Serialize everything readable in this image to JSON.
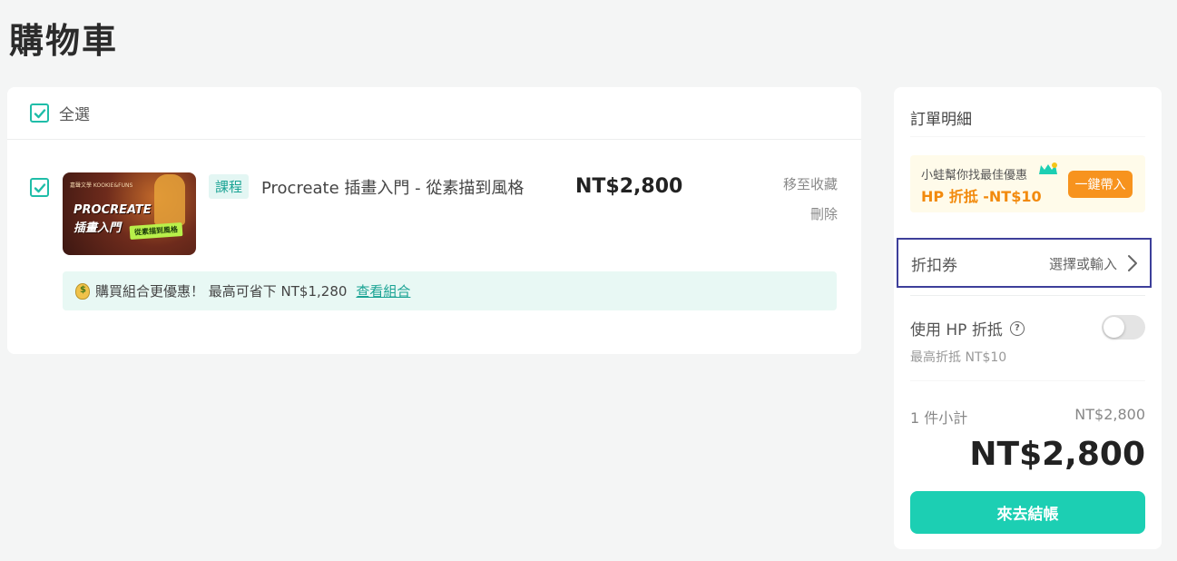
{
  "page": {
    "title": "購物車"
  },
  "cart": {
    "select_all_label": "全選",
    "select_all_checked": true,
    "items": [
      {
        "checked": true,
        "tag": "課程",
        "title": "Procreate 插畫入門 - 從素描到風格",
        "price": "NT$2,800",
        "thumb": {
          "line1": "嘉聲文學 KOOKIE&FUNS",
          "line2": "PROCREATE",
          "line3": "插畫入門",
          "badge": "從素描到風格"
        },
        "actions": {
          "favorite": "移至收藏",
          "delete": "刪除"
        },
        "bundle": {
          "text": "購買組合更優惠！ 最高可省下 NT$1,280",
          "link": "查看組合"
        }
      }
    ]
  },
  "summary": {
    "title": "訂單明細",
    "promo": {
      "hint": "小蛙幫你找最佳優惠",
      "offer": "HP 折抵 -NT$10",
      "button": "一鍵帶入"
    },
    "coupon": {
      "label": "折扣券",
      "action": "選擇或輸入"
    },
    "hp": {
      "label": "使用 HP 折抵",
      "help": "?",
      "max_text": "最高折抵 NT$10",
      "enabled": false
    },
    "subtotal": {
      "label": "1 件小計",
      "value": "NT$2,800"
    },
    "total": "NT$2,800",
    "checkout_button": "來去結帳"
  },
  "colors": {
    "accent": "#1ccfb3",
    "accent_text": "#1aa394",
    "promo_orange": "#f7931e",
    "highlight_border": "#3d3f9a",
    "background": "#f4f5f5"
  },
  "icons": [
    "check-icon",
    "money-bag-icon",
    "frog-crown-icon",
    "help-icon",
    "chevron-right-icon"
  ]
}
